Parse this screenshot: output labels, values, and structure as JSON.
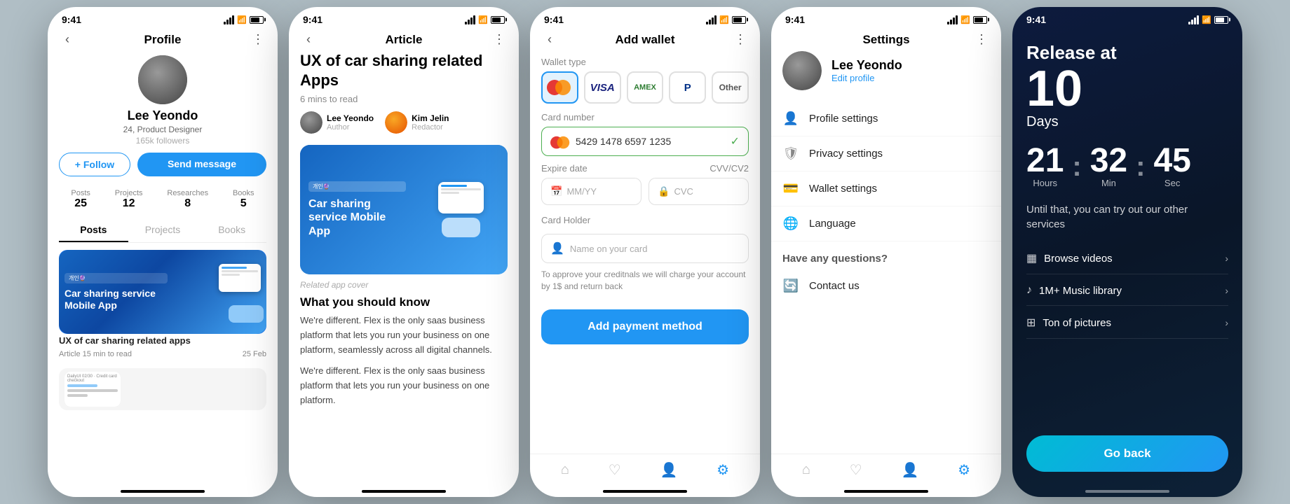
{
  "phones": [
    {
      "id": "profile",
      "theme": "light",
      "statusBar": {
        "time": "9:41"
      },
      "nav": {
        "title": "Profile",
        "hasBack": true,
        "hasMenu": true
      },
      "profile": {
        "name": "Lee Yeondo",
        "title": "24, Product Designer",
        "followers": "165k followers",
        "followBtn": "+ Follow",
        "messageBtn": "Send message",
        "stats": [
          {
            "label": "Posts",
            "value": "25"
          },
          {
            "label": "Projects",
            "value": "12"
          },
          {
            "label": "Researches",
            "value": "8"
          },
          {
            "label": "Books",
            "value": "5"
          }
        ],
        "tabs": [
          "Posts",
          "Projects",
          "Books"
        ],
        "activeTab": 0,
        "post": {
          "title": "UX of car sharing related apps",
          "meta": "Article 15 min to read",
          "date": "25 Feb",
          "cardTitle": "Car sharing service Mobile App",
          "cardBadge": "개인🔮"
        }
      }
    },
    {
      "id": "article",
      "theme": "light",
      "statusBar": {
        "time": "9:41"
      },
      "nav": {
        "title": "Article",
        "hasBack": true,
        "hasMenu": true
      },
      "article": {
        "title": "UX of car sharing related Apps",
        "readTime": "6 mins to read",
        "authors": [
          {
            "name": "Lee Yeondo",
            "role": "Author"
          },
          {
            "name": "Kim Jelin",
            "role": "Redactor"
          }
        ],
        "imageCaption": "Related app cover",
        "sectionTitle": "What you should know",
        "body1": "We're different. Flex is the only saas business platform that lets you run your business on one platform, seamlessly across all digital channels.",
        "body2": "We're different. Flex is the only saas business platform that lets you run your business on one platform.",
        "cardTitle": "Car sharing service Mobile App",
        "cardBadge": "개인🔮"
      }
    },
    {
      "id": "add-wallet",
      "theme": "light",
      "statusBar": {
        "time": "9:41"
      },
      "nav": {
        "title": "Add wallet",
        "hasBack": true,
        "hasMenu": true
      },
      "wallet": {
        "walletTypeLabel": "Wallet type",
        "types": [
          "Mastercard",
          "VISA",
          "AMEX",
          "PayPal",
          "Other"
        ],
        "selectedType": 0,
        "cardNumberLabel": "Card number",
        "cardNumber": "5429 1478 6597 1235",
        "expireDateLabel": "Expire date",
        "cvvLabel": "CVV/CV2",
        "expirePlaceholder": "MM/YY",
        "cvcPlaceholder": "CVC",
        "cardHolderLabel": "Card Holder",
        "namePlaceholder": "Name on your card",
        "note": "To approve your creditnals we will charge your account by 1$ and return back",
        "addBtn": "Add payment method",
        "bottomNav": [
          "home",
          "heart",
          "user",
          "settings"
        ]
      }
    },
    {
      "id": "settings",
      "theme": "light",
      "statusBar": {
        "time": "9:41"
      },
      "nav": {
        "title": "Settings",
        "hasBack": false,
        "hasMenu": true
      },
      "settings": {
        "name": "Lee Yeondo",
        "editLabel": "Edit profile",
        "menuItems": [
          {
            "icon": "👤",
            "label": "Profile settings"
          },
          {
            "icon": "🛡",
            "label": "Privacy settings"
          },
          {
            "icon": "💳",
            "label": "Wallet settings"
          },
          {
            "icon": "🌐",
            "label": "Language"
          }
        ],
        "helpSection": "Have any questions?",
        "contactLabel": "Contact us",
        "bottomNav": [
          "home",
          "heart",
          "user",
          "settings"
        ]
      }
    },
    {
      "id": "countdown",
      "theme": "dark",
      "statusBar": {
        "time": "9:41"
      },
      "countdown": {
        "releaseLabel": "Release at",
        "days": "10",
        "daysLabel": "Days",
        "hours": "21",
        "hoursLabel": "Hours",
        "minutes": "32",
        "minutesLabel": "Min",
        "seconds": "45",
        "secondsLabel": "Sec",
        "untilText": "Until that, you can try out our other services",
        "services": [
          {
            "icon": "▦",
            "label": "Browse videos"
          },
          {
            "icon": "♪",
            "label": "1M+ Music library"
          },
          {
            "icon": "⊞",
            "label": "Ton of pictures"
          }
        ],
        "goBackBtn": "Go back"
      }
    }
  ]
}
